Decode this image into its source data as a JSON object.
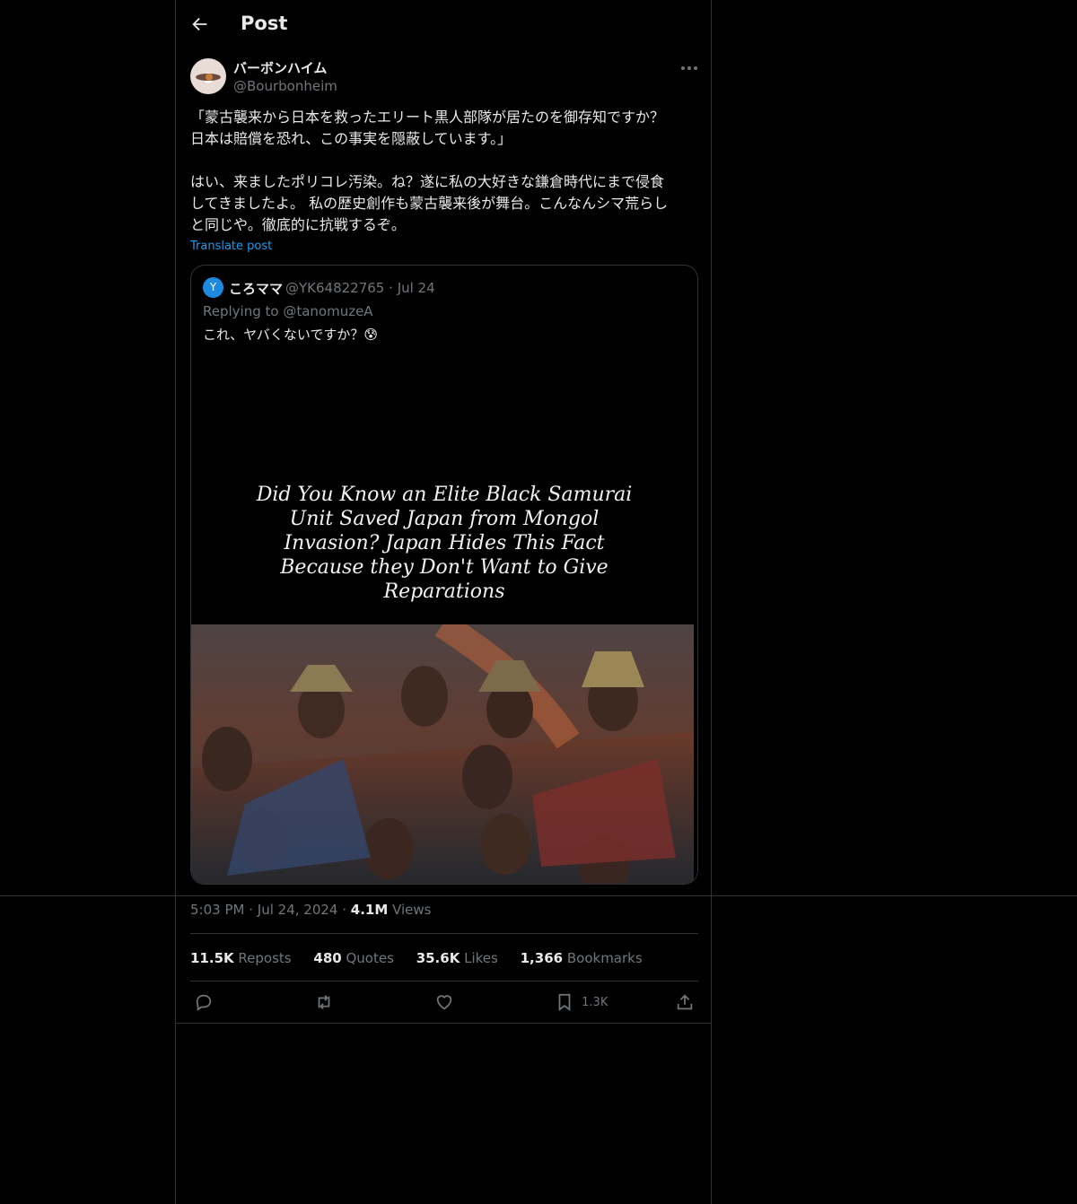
{
  "header": {
    "title": "Post"
  },
  "post": {
    "author_name": "バーボンハイム",
    "author_handle": "@Bourbonheim",
    "text": "「蒙古襲来から日本を救ったエリート黒人部隊が居たのを御存知ですか？\n日本は賠償を恐れ、この事実を隠蔽しています。」\n\nはい、来ましたポリコレ汚染。ね？遂に私の大好きな鎌倉時代にまで侵食\nしてきましたよ。 私の歴史創作も蒙古襲来後が舞台。こんなんシマ荒らし\nと同じや。徹底的に抗戦するぞ。",
    "translate_label": "Translate post",
    "time": "5:03 PM",
    "date": "Jul 24, 2024",
    "views_count": "4.1M",
    "views_label": "Views"
  },
  "quote": {
    "avatar_letter": "Y",
    "name": "ころママ",
    "handle": "@YK64822765",
    "date": "Jul 24",
    "replying": "Replying to @tanomuzeA",
    "text": "これ、ヤバくないですか？😰",
    "image_caption": "Did You Know an Elite Black Samurai Unit Saved Japan from Mongol Invasion? Japan Hides This Fact Because they Don't Want to Give Reparations"
  },
  "stats": {
    "reposts_count": "11.5K",
    "reposts_label": "Reposts",
    "quotes_count": "480",
    "quotes_label": "Quotes",
    "likes_count": "35.6K",
    "likes_label": "Likes",
    "bookmarks_count": "1,366",
    "bookmarks_label": "Bookmarks"
  },
  "actions": {
    "bookmark_count": "1.3K"
  },
  "colors": {
    "background": "#000000",
    "text": "#e7e9ea",
    "muted": "#71767b",
    "link": "#1d9bf0",
    "border": "#2f3336"
  }
}
